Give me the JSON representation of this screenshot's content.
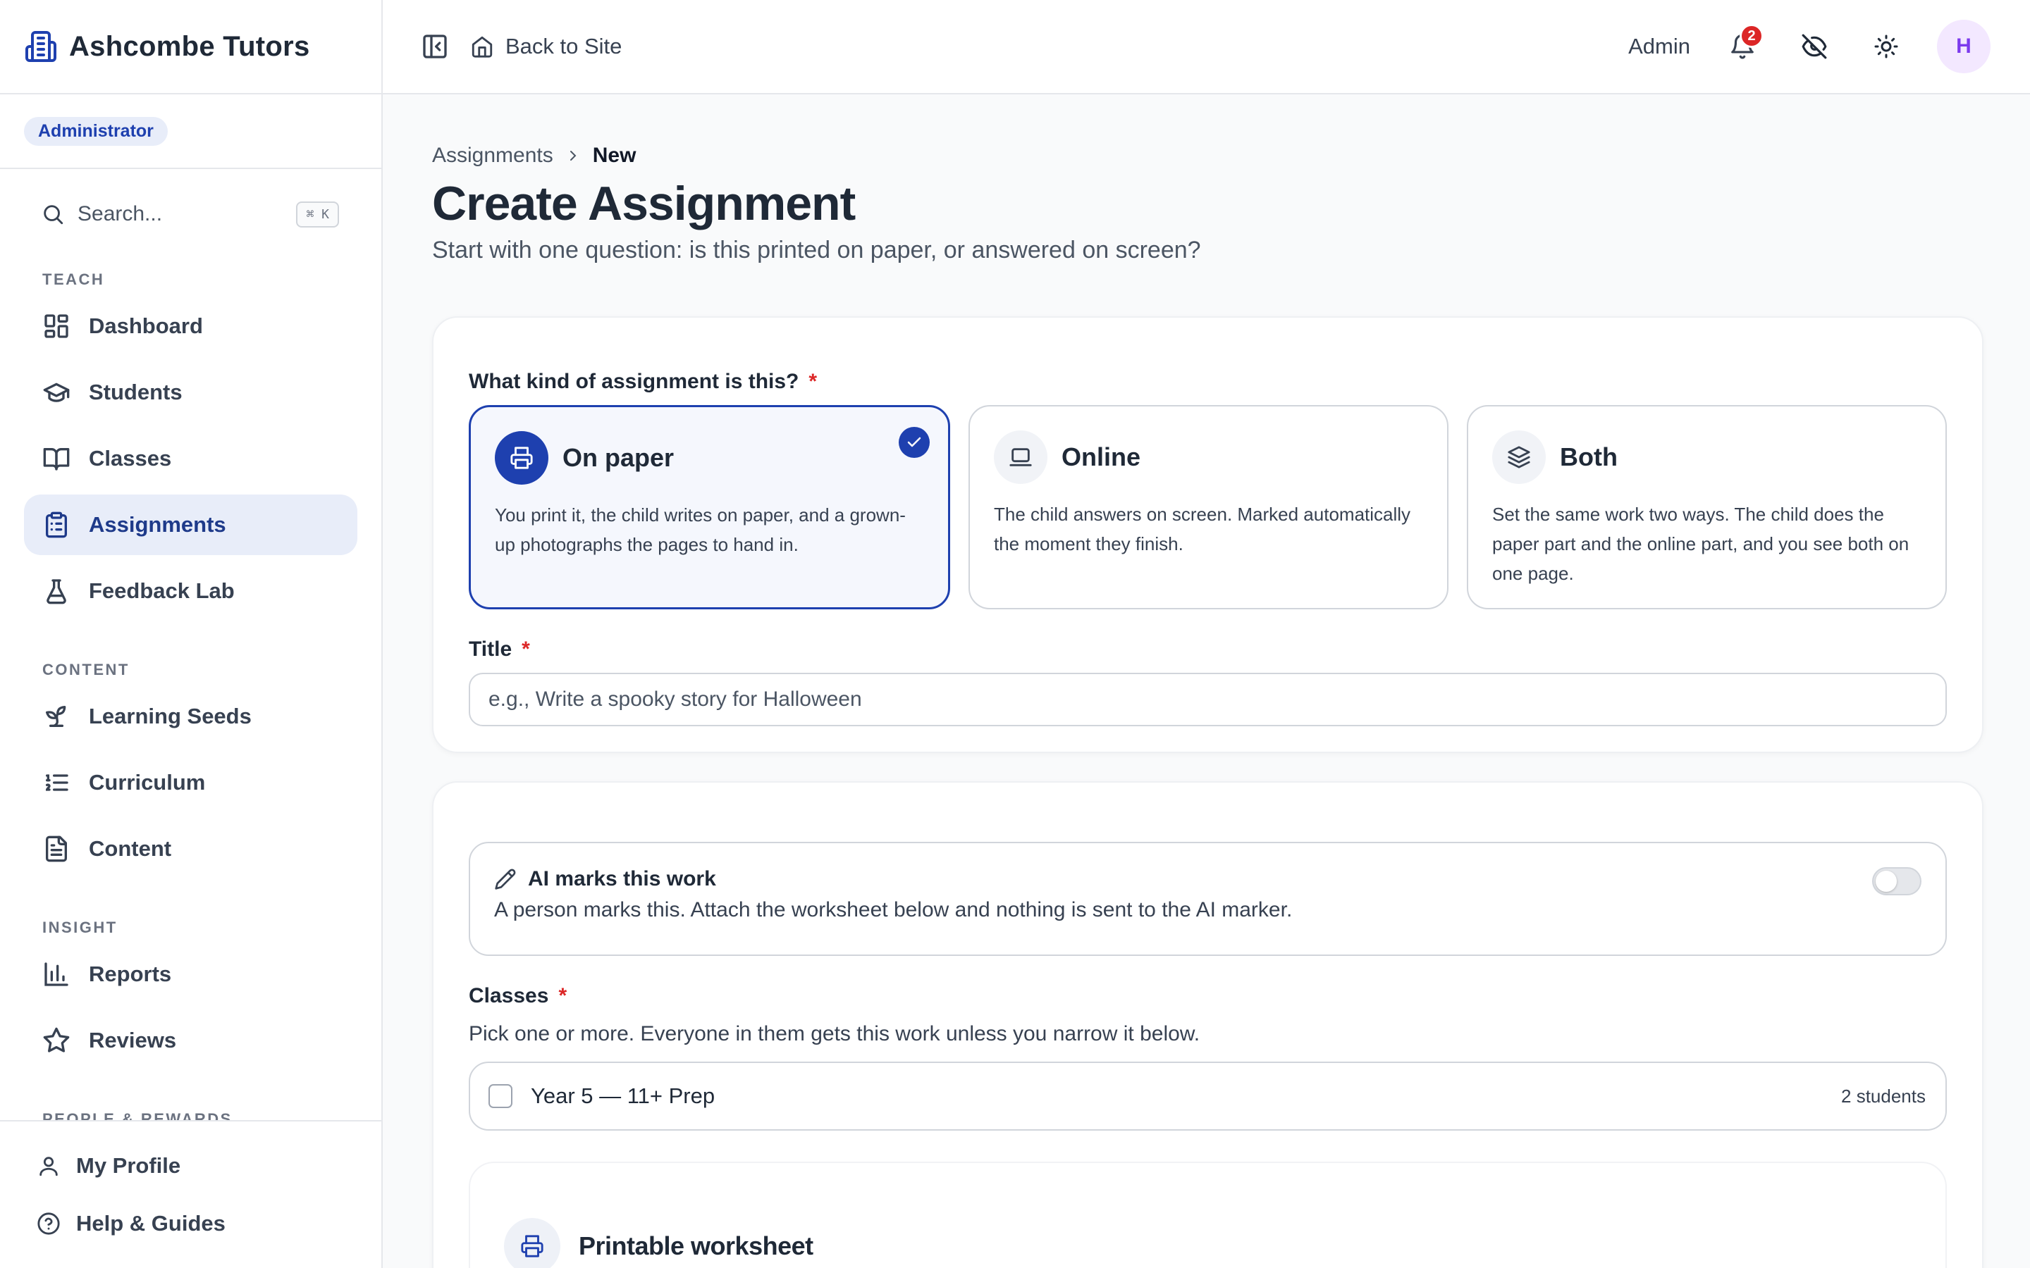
{
  "brand": {
    "name": "Ashcombe Tutors",
    "icon": "building-icon"
  },
  "role_badge": "Administrator",
  "search": {
    "placeholder": "Search...",
    "shortcut": "⌘ K"
  },
  "sidebar": {
    "sections": [
      {
        "label": "TEACH",
        "items": [
          {
            "label": "Dashboard",
            "icon": "dashboard-icon"
          },
          {
            "label": "Students",
            "icon": "graduation-cap-icon"
          },
          {
            "label": "Classes",
            "icon": "book-open-icon"
          },
          {
            "label": "Assignments",
            "icon": "clipboard-icon",
            "active": true
          },
          {
            "label": "Feedback Lab",
            "icon": "flask-icon"
          }
        ]
      },
      {
        "label": "CONTENT",
        "items": [
          {
            "label": "Learning Seeds",
            "icon": "sprout-icon"
          },
          {
            "label": "Curriculum",
            "icon": "list-ordered-icon"
          },
          {
            "label": "Content",
            "icon": "file-text-icon"
          }
        ]
      },
      {
        "label": "INSIGHT",
        "items": [
          {
            "label": "Reports",
            "icon": "bar-chart-icon"
          },
          {
            "label": "Reviews",
            "icon": "star-icon"
          }
        ]
      },
      {
        "label": "PEOPLE & REWARDS",
        "items": []
      }
    ],
    "footer": [
      {
        "label": "My Profile",
        "icon": "user-icon"
      },
      {
        "label": "Help & Guides",
        "icon": "help-circle-icon"
      }
    ]
  },
  "topbar": {
    "back_label": "Back to Site",
    "admin_label": "Admin",
    "notification_count": "2",
    "avatar_initial": "H"
  },
  "breadcrumb": {
    "parent": "Assignments",
    "current": "New"
  },
  "page": {
    "title": "Create Assignment",
    "subtitle": "Start with one question: is this printed on paper, or answered on screen?"
  },
  "kind": {
    "label": "What kind of assignment is this?",
    "required": "*",
    "options": [
      {
        "title": "On paper",
        "desc": "You print it, the child writes on paper, and a grown-up photographs the pages to hand in.",
        "icon": "printer-icon",
        "selected": true
      },
      {
        "title": "Online",
        "desc": "The child answers on screen. Marked automatically the moment they finish.",
        "icon": "laptop-icon",
        "selected": false
      },
      {
        "title": "Both",
        "desc": "Set the same work two ways. The child does the paper part and the online part, and you see both on one page.",
        "icon": "layers-icon",
        "selected": false
      }
    ]
  },
  "title_field": {
    "label": "Title",
    "required": "*",
    "placeholder": "e.g., Write a spooky story for Halloween"
  },
  "ai_marking": {
    "title": "AI marks this work",
    "desc": "A person marks this. Attach the worksheet below and nothing is sent to the AI marker.",
    "enabled": false
  },
  "classes": {
    "label": "Classes",
    "required": "*",
    "help": "Pick one or more. Everyone in them gets this work unless you narrow it below.",
    "items": [
      {
        "name": "Year 5 — 11+ Prep",
        "count": "2 students"
      }
    ]
  },
  "worksheet": {
    "title": "Printable worksheet"
  },
  "colors": {
    "accent": "#1e40af",
    "danger": "#dc2626",
    "avatar_bg": "#f3e8ff",
    "avatar_fg": "#7c3aed"
  }
}
